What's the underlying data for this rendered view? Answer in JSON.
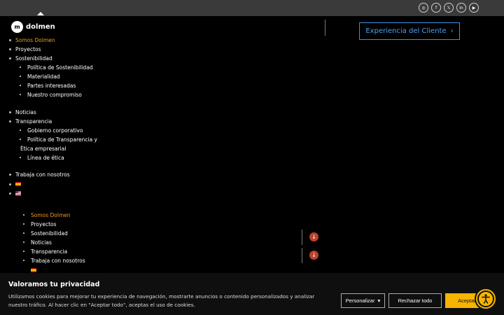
{
  "header": {
    "socials": [
      {
        "icon": "instagram-icon",
        "glyph": "◎"
      },
      {
        "icon": "facebook-icon",
        "glyph": "f"
      },
      {
        "icon": "x-icon",
        "glyph": "𝕏"
      },
      {
        "icon": "linkedin-icon",
        "glyph": "in"
      },
      {
        "icon": "youtube-icon",
        "glyph": "▶"
      }
    ],
    "logo_text": "dolmen",
    "logo_mark": "m",
    "cta_label": "Experiencia del Cliente",
    "cta_arrow": "›"
  },
  "menu": {
    "somos": "Somos Dolmen",
    "proyectos": "Proyectos",
    "sostenibilidad": "Sostenibilidad",
    "politica_sost": "Política de Sostenibilidad",
    "materialidad": "Materialidad",
    "partes": "Partes interesadas",
    "compromiso": "Nuestro compromiso",
    "noticias": "Noticias",
    "transparencia": "Transparencia",
    "gobierno": "Gobierno corporativo",
    "politica_transp_1": "Política de Transparencia y",
    "politica_transp_2": "Ética empresarial",
    "linea_etica": "Línea de ética",
    "trabaja": "Trabaja con nosotros"
  },
  "mobile_menu": {
    "somos": "Somos Dolmen",
    "proyectos": "Proyectos",
    "sostenibilidad": "Sostenibilidad",
    "noticias": "Noticias",
    "transparencia": "Transparencia",
    "trabaja": "Trabaja con nosotros",
    "arrow": "↓"
  },
  "cookie": {
    "title": "Valoramos tu privacidad",
    "text": "Utilizamos cookies para mejorar tu experiencia de navegación, mostrarte anuncios o contenido personalizados y analizar nuestro tráfico. Al hacer clic en \"Aceptar todo\", aceptas el uso de cookies.",
    "customize": "Personalizar",
    "reject": "Rechazar todo",
    "accept": "Aceptar"
  },
  "colors": {
    "accent_orange": "#f29b1f",
    "cta_blue": "#3b8fe6",
    "accept_yellow": "#f7b500",
    "arrow_red": "#b9432b"
  }
}
